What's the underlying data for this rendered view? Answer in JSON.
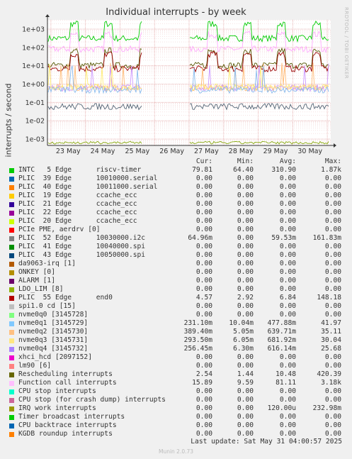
{
  "title": "Individual interrupts - by week",
  "side_label": "RRDTOOL / TOBI OETIKER",
  "ylabel": "interrupts / second",
  "chart_data": {
    "type": "line",
    "title": "Individual interrupts - by week",
    "ylabel": "interrupts / second",
    "yscale": "log",
    "ylim": [
      0.0005,
      2000
    ],
    "yticks": [
      "1e+03",
      "1e+02",
      "1e+01",
      "1e+00",
      "1e-01",
      "1e-02",
      "1e-03"
    ],
    "xticks": [
      "23 May",
      "24 May",
      "25 May",
      "26 May",
      "27 May",
      "28 May",
      "29 May",
      "30 May"
    ],
    "grid": true,
    "series": [
      {
        "name": "INTC 5 Edge riscv-timer",
        "color": "#00cc00",
        "avg": 310.9
      },
      {
        "name": "Function call interrupts",
        "color": "#ffaaff",
        "avg": 81.11
      },
      {
        "name": "Rescheduling interrupts",
        "color": "#555500",
        "avg": 10.48
      },
      {
        "name": "PLIC 55 Edge end0",
        "color": "#990000",
        "avg": 6.84
      },
      {
        "name": "nvme0q2 [3145730]",
        "color": "#ffbb77",
        "avg": 0.6397
      },
      {
        "name": "nvme0q4 [3145732]",
        "color": "#cc99ff",
        "avg": 0.6161
      },
      {
        "name": "nvme0q3 [3145731]",
        "color": "#ffee77",
        "avg": 0.6819
      },
      {
        "name": "nvme0q1 [3145729]",
        "color": "#88bbee",
        "avg": 0.4779
      },
      {
        "name": "PLIC 52 Edge 10030000.i2c",
        "color": "#556677",
        "avg": 0.05953
      },
      {
        "name": "IRQ work interrupts",
        "color": "#88aa11",
        "avg": 0.00012
      }
    ]
  },
  "legend": {
    "headers": [
      "Cur:",
      "Min:",
      "Avg:",
      "Max:"
    ],
    "rows": [
      {
        "color": "#00cc00",
        "name": "INTC   5 Edge      riscv-timer",
        "cur": "79.81",
        "min": "64.40",
        "avg": "310.90",
        "max": "1.87k"
      },
      {
        "color": "#0066b3",
        "name": "PLIC  39 Edge      10010000.serial",
        "cur": "0.00",
        "min": "0.00",
        "avg": "0.00",
        "max": "0.00"
      },
      {
        "color": "#ff8000",
        "name": "PLIC  40 Edge      10011000.serial",
        "cur": "0.00",
        "min": "0.00",
        "avg": "0.00",
        "max": "0.00"
      },
      {
        "color": "#ffcc00",
        "name": "PLIC  19 Edge      ccache_ecc",
        "cur": "0.00",
        "min": "0.00",
        "avg": "0.00",
        "max": "0.00"
      },
      {
        "color": "#330099",
        "name": "PLIC  21 Edge      ccache_ecc",
        "cur": "0.00",
        "min": "0.00",
        "avg": "0.00",
        "max": "0.00"
      },
      {
        "color": "#990099",
        "name": "PLIC  22 Edge      ccache_ecc",
        "cur": "0.00",
        "min": "0.00",
        "avg": "0.00",
        "max": "0.00"
      },
      {
        "color": "#ccff00",
        "name": "PLIC  20 Edge      ccache_ecc",
        "cur": "0.00",
        "min": "0.00",
        "avg": "0.00",
        "max": "0.00"
      },
      {
        "color": "#ff0000",
        "name": "PCIe PME, aerdrv [0]",
        "cur": "0.00",
        "min": "0.00",
        "avg": "0.00",
        "max": "0.00"
      },
      {
        "color": "#808080",
        "name": "PLIC  52 Edge      10030000.i2c",
        "cur": "64.96m",
        "min": "0.00",
        "avg": "59.53m",
        "max": "161.83m"
      },
      {
        "color": "#008f00",
        "name": "PLIC  41 Edge      10040000.spi",
        "cur": "0.00",
        "min": "0.00",
        "avg": "0.00",
        "max": "0.00"
      },
      {
        "color": "#00487d",
        "name": "PLIC  43 Edge      10050000.spi",
        "cur": "0.00",
        "min": "0.00",
        "avg": "0.00",
        "max": "0.00"
      },
      {
        "color": "#b35a00",
        "name": "da9063-irq [1]",
        "cur": "0.00",
        "min": "0.00",
        "avg": "0.00",
        "max": "0.00"
      },
      {
        "color": "#b38f00",
        "name": "ONKEY [0]",
        "cur": "0.00",
        "min": "0.00",
        "avg": "0.00",
        "max": "0.00"
      },
      {
        "color": "#6b006b",
        "name": "ALARM [1]",
        "cur": "0.00",
        "min": "0.00",
        "avg": "0.00",
        "max": "0.00"
      },
      {
        "color": "#8fb300",
        "name": "LDO_LIM [8]",
        "cur": "0.00",
        "min": "0.00",
        "avg": "0.00",
        "max": "0.00"
      },
      {
        "color": "#b30000",
        "name": "PLIC  55 Edge      end0",
        "cur": "4.57",
        "min": "2.92",
        "avg": "6.84",
        "max": "148.18"
      },
      {
        "color": "#bebebe",
        "name": "spi1.0 cd [15]",
        "cur": "0.00",
        "min": "0.00",
        "avg": "0.00",
        "max": "0.00"
      },
      {
        "color": "#80ff80",
        "name": "nvme0q0 [3145728]",
        "cur": "0.00",
        "min": "0.00",
        "avg": "0.00",
        "max": "0.00"
      },
      {
        "color": "#80c9ff",
        "name": "nvme0q1 [3145729]",
        "cur": "231.10m",
        "min": "10.04m",
        "avg": "477.88m",
        "max": "41.97"
      },
      {
        "color": "#ffc080",
        "name": "nvme0q2 [3145730]",
        "cur": "389.40m",
        "min": "5.05m",
        "avg": "639.71m",
        "max": "35.11"
      },
      {
        "color": "#ffe680",
        "name": "nvme0q3 [3145731]",
        "cur": "293.50m",
        "min": "6.05m",
        "avg": "681.92m",
        "max": "30.04"
      },
      {
        "color": "#aa80ff",
        "name": "nvme0q4 [3145732]",
        "cur": "256.45m",
        "min": "6.30m",
        "avg": "616.14m",
        "max": "25.68"
      },
      {
        "color": "#ee00cc",
        "name": "xhci_hcd [2097152]",
        "cur": "0.00",
        "min": "0.00",
        "avg": "0.00",
        "max": "0.00"
      },
      {
        "color": "#ff8080",
        "name": "lm90 [6]",
        "cur": "0.00",
        "min": "0.00",
        "avg": "0.00",
        "max": "0.00"
      },
      {
        "color": "#666600",
        "name": "Rescheduling interrupts",
        "cur": "2.54",
        "min": "1.44",
        "avg": "10.48",
        "max": "420.39"
      },
      {
        "color": "#ffbfff",
        "name": "Function call interrupts",
        "cur": "15.89",
        "min": "9.59",
        "avg": "81.11",
        "max": "3.18k"
      },
      {
        "color": "#00ffcc",
        "name": "CPU stop interrupts",
        "cur": "0.00",
        "min": "0.00",
        "avg": "0.00",
        "max": "0.00"
      },
      {
        "color": "#cc6699",
        "name": "CPU stop (for crash dump) interrupts",
        "cur": "0.00",
        "min": "0.00",
        "avg": "0.00",
        "max": "0.00"
      },
      {
        "color": "#999900",
        "name": "IRQ work interrupts",
        "cur": "0.00",
        "min": "0.00",
        "avg": "120.00u",
        "max": "232.98m"
      },
      {
        "color": "#00cc00",
        "name": "Timer broadcast interrupts",
        "cur": "0.00",
        "min": "0.00",
        "avg": "0.00",
        "max": "0.00"
      },
      {
        "color": "#0066b3",
        "name": "CPU backtrace interrupts",
        "cur": "0.00",
        "min": "0.00",
        "avg": "0.00",
        "max": "0.00"
      },
      {
        "color": "#ff8000",
        "name": "KGDB roundup interrupts",
        "cur": "0.00",
        "min": "0.00",
        "avg": "0.00",
        "max": "0.00"
      }
    ]
  },
  "last_update": "Last update: Sat May 31 04:00:57 2025",
  "munin_version": "Munin 2.0.73"
}
